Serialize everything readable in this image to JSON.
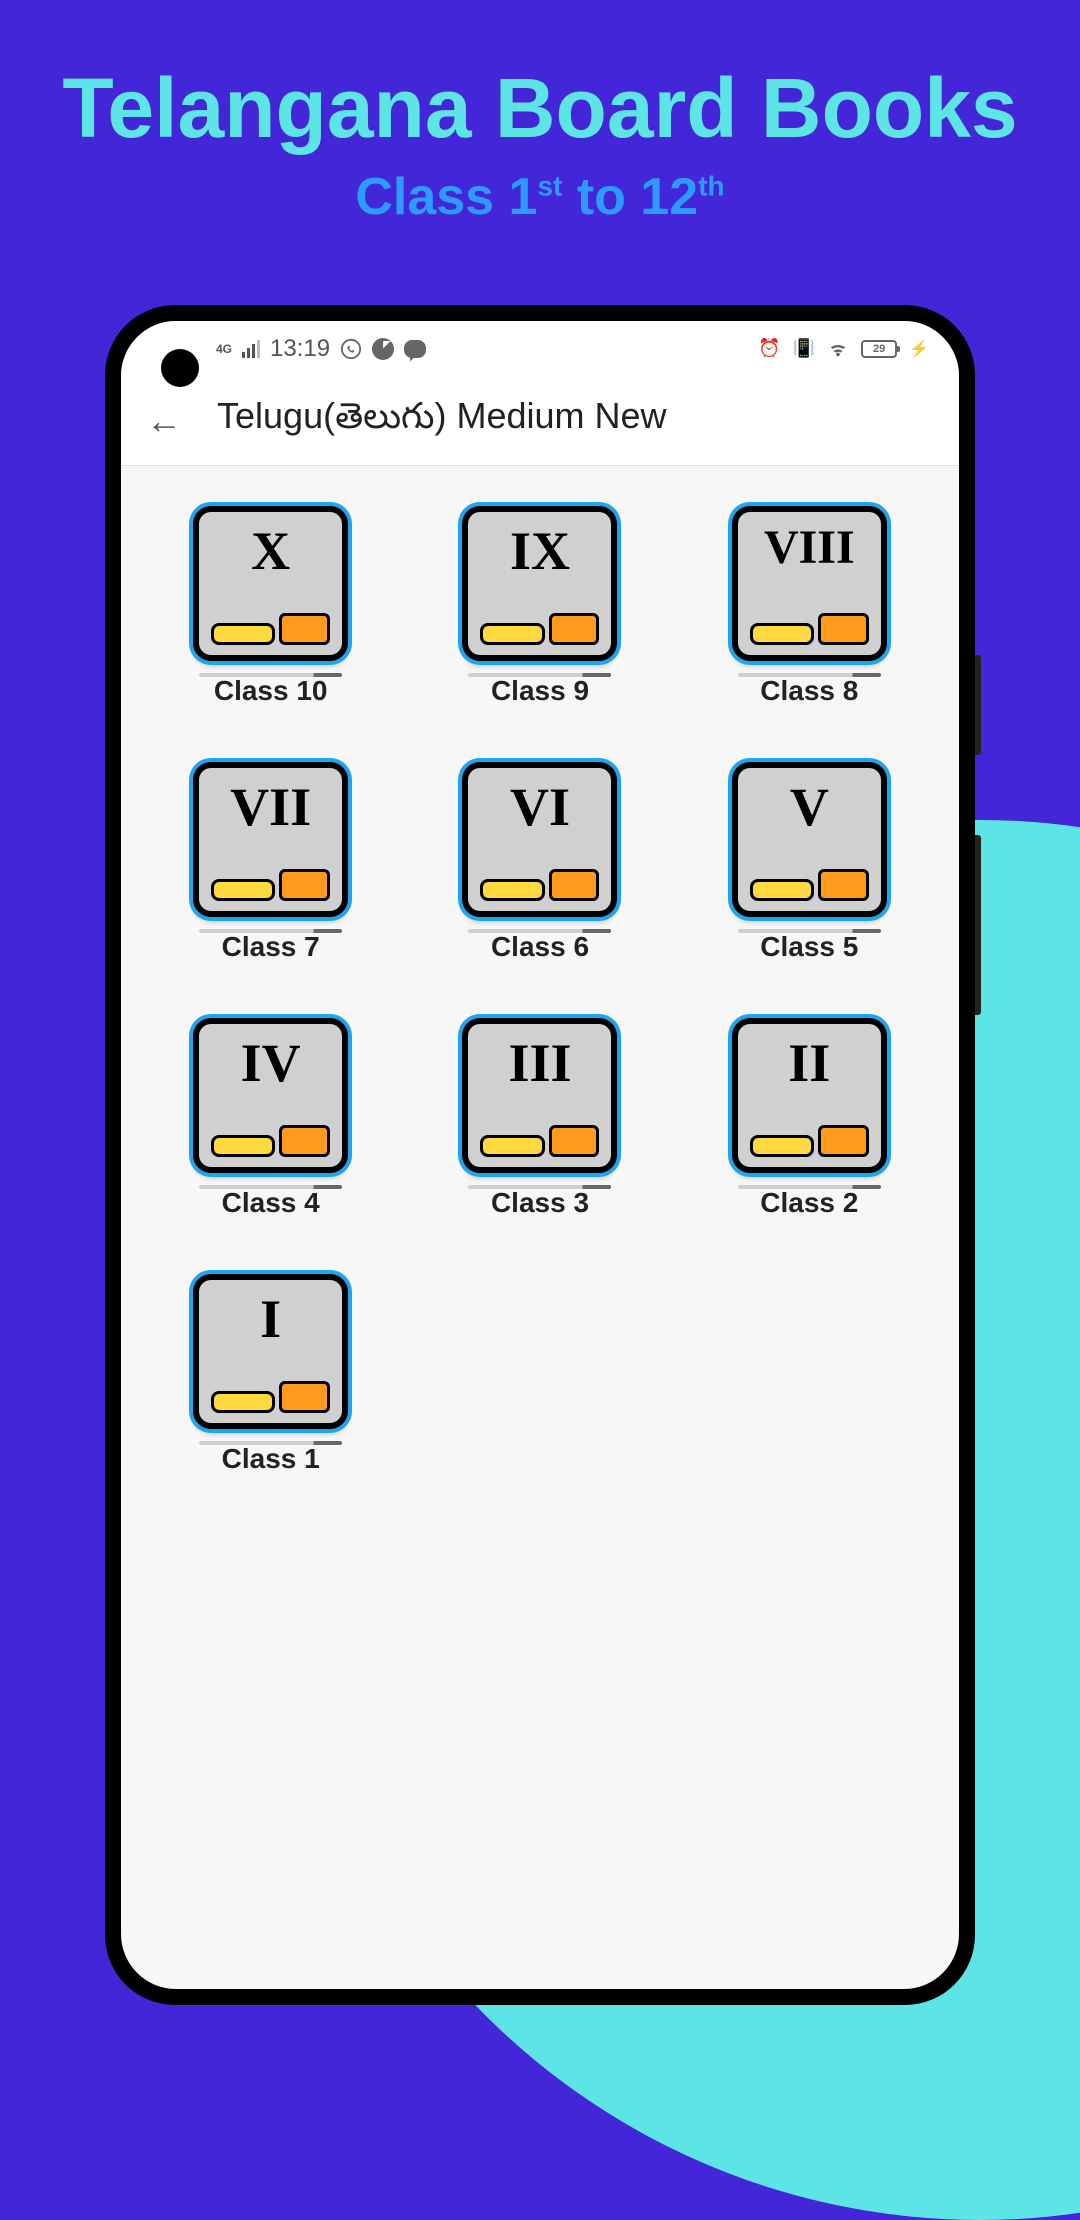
{
  "hero": {
    "title": "Telangana Board Books",
    "subtitle_prefix": "Class 1",
    "subtitle_sup1": "st",
    "subtitle_mid": " to 12",
    "subtitle_sup2": "th"
  },
  "statusbar": {
    "signal_type": "4G",
    "time": "13:19",
    "battery_level": "29"
  },
  "appbar": {
    "title": "Telugu(తెలుగు) Medium New"
  },
  "classes": [
    {
      "roman": "X",
      "label": "Class 10"
    },
    {
      "roman": "IX",
      "label": "Class 9"
    },
    {
      "roman": "VIII",
      "label": "Class 8"
    },
    {
      "roman": "VII",
      "label": "Class 7"
    },
    {
      "roman": "VI",
      "label": "Class 6"
    },
    {
      "roman": "V",
      "label": "Class 5"
    },
    {
      "roman": "IV",
      "label": "Class 4"
    },
    {
      "roman": "III",
      "label": "Class 3"
    },
    {
      "roman": "II",
      "label": "Class 2"
    },
    {
      "roman": "I",
      "label": "Class 1"
    }
  ]
}
